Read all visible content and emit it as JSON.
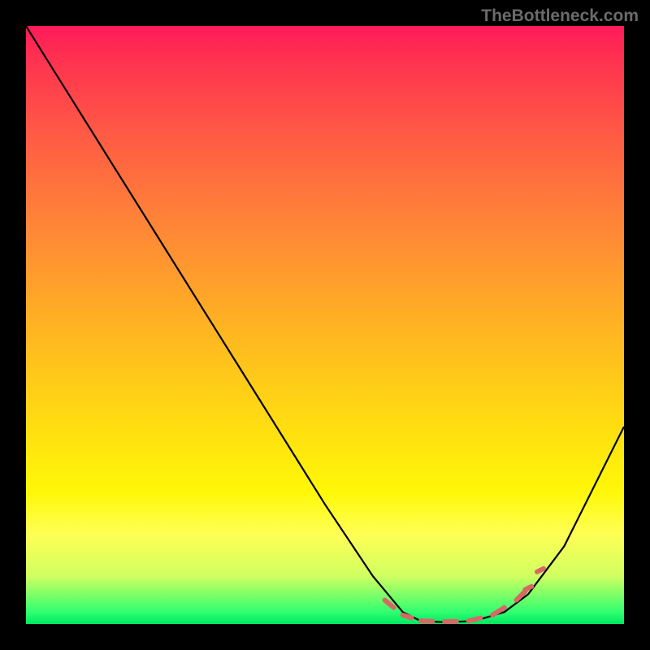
{
  "watermark": "TheBottleneck.com",
  "chart_data": {
    "type": "line",
    "title": "",
    "xlabel": "",
    "ylabel": "",
    "xlim": [
      0,
      100
    ],
    "ylim": [
      0,
      100
    ],
    "grid": false,
    "legend": false,
    "curve": {
      "description": "V-shaped bottleneck curve over gradient background; no visible axis ticks or numeric labels",
      "x": [
        0,
        5,
        10,
        20,
        30,
        40,
        50,
        58,
        63,
        66,
        70,
        75,
        80,
        84,
        90,
        100
      ],
      "y": [
        100,
        92,
        84,
        68,
        52,
        36,
        20,
        8,
        2,
        0.5,
        0.3,
        0.5,
        2,
        5,
        13,
        33
      ],
      "color": "#000000"
    },
    "markers": {
      "description": "Dashed marker segments near the minimum of the curve",
      "color": "#d86868",
      "points": [
        {
          "x": 60,
          "y": 4
        },
        {
          "x": 63,
          "y": 1.5
        },
        {
          "x": 66,
          "y": 0.5
        },
        {
          "x": 70,
          "y": 0.4
        },
        {
          "x": 74,
          "y": 0.5
        },
        {
          "x": 78,
          "y": 1.5
        },
        {
          "x": 82,
          "y": 4
        },
        {
          "x": 85,
          "y": 7
        }
      ]
    },
    "background_gradient": {
      "stops": [
        {
          "pos": 0,
          "color": "#ff1a5a"
        },
        {
          "pos": 50,
          "color": "#ffb820"
        },
        {
          "pos": 85,
          "color": "#ffff55"
        },
        {
          "pos": 100,
          "color": "#00e860"
        }
      ]
    }
  }
}
